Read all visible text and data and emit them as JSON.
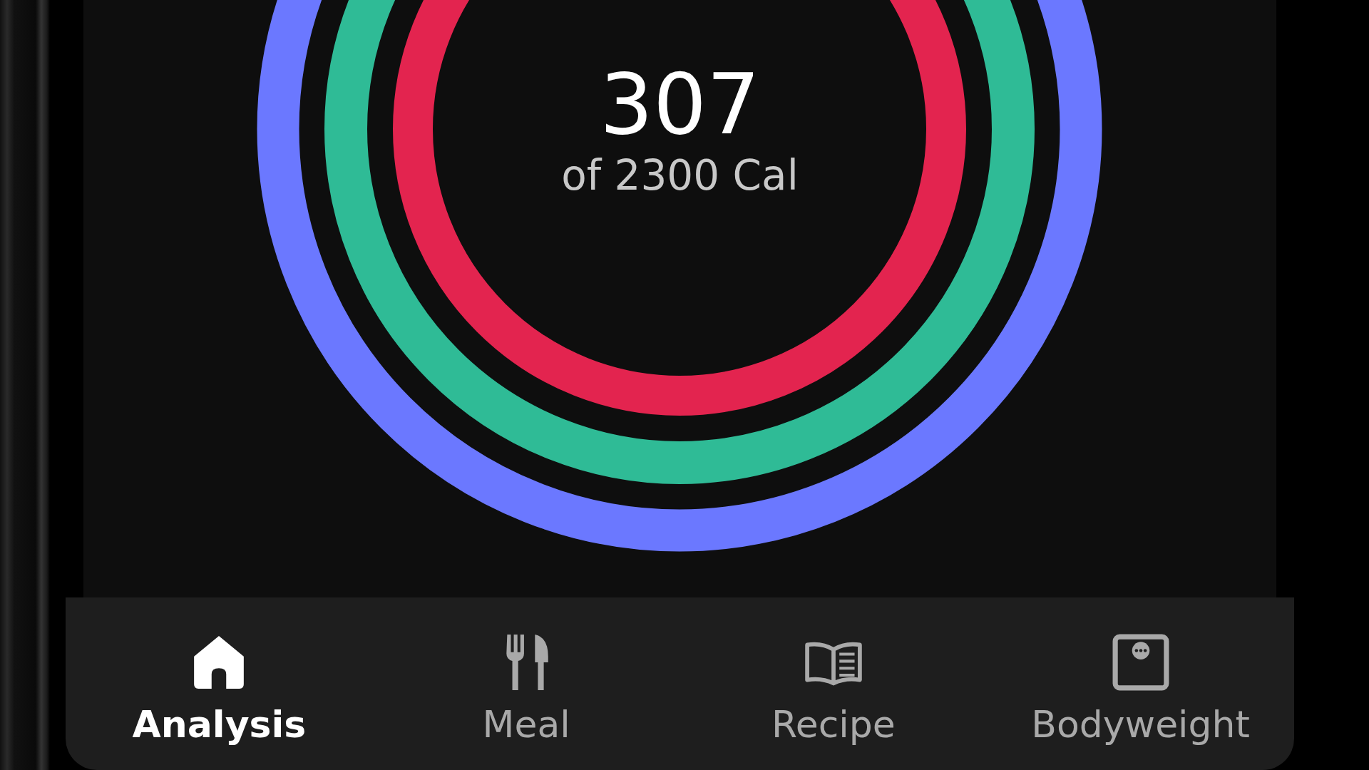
{
  "summary": {
    "value": "307",
    "caption": "of 2300 Cal"
  },
  "rings": [
    {
      "color": "#6b78ff"
    },
    {
      "color": "#2fbb96"
    },
    {
      "color": "#e3244f"
    }
  ],
  "tabs": [
    {
      "label": "Analysis",
      "kind": "home",
      "selected": true
    },
    {
      "label": "Meal",
      "kind": "meal",
      "selected": false
    },
    {
      "label": "Recipe",
      "kind": "recipe",
      "selected": false
    },
    {
      "label": "Bodyweight",
      "kind": "scale",
      "selected": false
    }
  ]
}
